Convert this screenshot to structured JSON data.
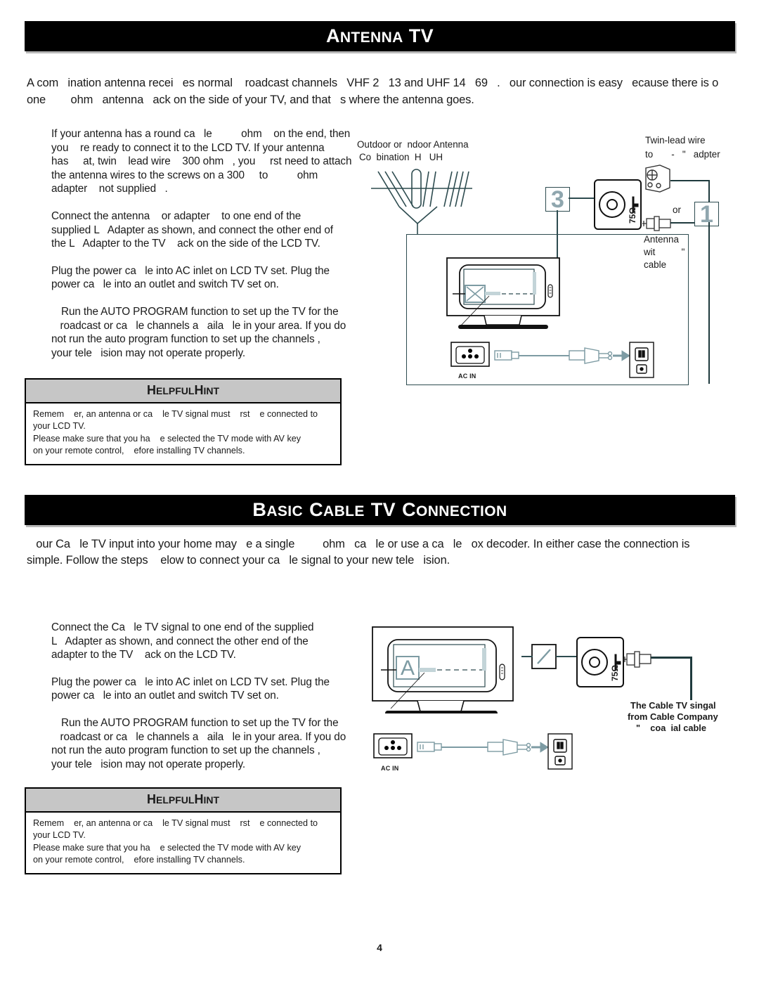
{
  "document": {
    "page_number": "4"
  },
  "section1": {
    "header": {
      "cap1": "A",
      "rest1": "NTENNA",
      "cap2": "TV"
    },
    "intro_line1": "A com   ination antenna recei   es normal    roadcast channels   VHF 2   13 and UHF 14   69   .   our connection is easy   ecause there is o",
    "intro_line2": "one        ohm   antenna   ack on the side of your TV, and that   s where the antenna goes.",
    "paragraphs": [
      "If your antenna has a round ca   le          ohm    on the end, then\nyou    re ready to connect it to the LCD TV. If your antenna\nhas     at, twin    lead wire    300 ohm   , you     rst need to attach\nthe antenna wires to the screws on a 300     to          ohm\nadapter    not supplied   .",
      "Connect the antenna    or adapter    to one end of the\nsupplied L   Adapter as shown, and connect the other end of\nthe L   Adapter to the TV    ack on the side of the LCD TV.",
      "Plug the power ca   le into AC inlet on LCD TV set. Plug the\npower ca   le into an outlet and switch TV set on.",
      "Run the AUTO PROGRAM function to set up the TV for the\n   roadcast or ca   le channels a   aila   le in your area. If you do\nnot run the auto program function to set up the channels ,\nyour tele   ision may not operate properly."
    ],
    "hint": {
      "title_cap1": "H",
      "title_rest1": "ELPFUL",
      "title_cap2": "H",
      "title_rest2": "INT",
      "body": "Remem    er, an antenna or ca    le TV signal must    rst    e connected to\nyour LCD TV.\nPlease make sure that you ha    e selected the TV mode with AV key\non your remote control,    efore installing TV channels."
    },
    "diagram": {
      "antenna_label_line1": "Outdoor or  ndoor Antenna",
      "antenna_label_line2": "Co  bination  H   UH",
      "twin_lead_line1": "Twin-lead wire",
      "twin_lead_line2": "to       -   \"   adpter",
      "or_label": "or",
      "antenna_cable_line1": "Antenna",
      "antenna_cable_line2": "wit          \"",
      "antenna_cable_line3": "cable",
      "jack_ohm": "75Ω",
      "step_3": "3",
      "step_1": "1",
      "ac_in": "AC IN"
    }
  },
  "section2": {
    "header": {
      "cap1": "B",
      "rest1": "ASIC",
      "cap2": "C",
      "rest2": "ABLE",
      "cap3": "TV",
      "cap4": "C",
      "rest4": "ONNECTION"
    },
    "intro_line1": "   our Ca   le TV input into your home may   e a single         ohm   ca   le or use a ca   le   ox decoder. In either case the connection is",
    "intro_line2": "simple. Follow the steps    elow to connect your ca   le signal to your new tele   ision.",
    "paragraphs": [
      "Connect the Ca   le TV signal to one end of the supplied\nL   Adapter as shown, and connect the other end of the\nadapter to the TV    ack on the LCD TV.",
      "Plug the power ca   le into AC inlet on LCD TV set. Plug the\npower ca   le into an outlet and switch TV set on.",
      "Run the AUTO PROGRAM function to set up the TV for the\n   roadcast or ca   le channels a   aila   le in your area. If you do\nnot run the auto program function to set up the channels ,\nyour tele   ision may not operate properly."
    ],
    "hint": {
      "title_cap1": "H",
      "title_rest1": "ELPFUL",
      "title_cap2": "H",
      "title_rest2": "INT",
      "body": "Remem    er, an antenna or ca    le TV signal must    rst    e connected to\nyour LCD TV.\nPlease make sure that you ha    e selected the TV mode with AV key\non your remote control,    efore installing TV channels."
    },
    "diagram": {
      "screen_letter": "A",
      "jack_ohm": "75Ω",
      "cable_note_line1": "The Cable TV singal",
      "cable_note_line2": "from Cable Company",
      "cable_note_line3": "\"    coa  ial cable",
      "ac_in": "AC IN"
    }
  },
  "colors": {
    "bar_bg": "#000000",
    "hint_header_bg": "#c6c6c6",
    "diagram_line": "#2d4b4f",
    "accent_number": "#8fa6ae",
    "cable_teal": "#9fb8bd"
  }
}
